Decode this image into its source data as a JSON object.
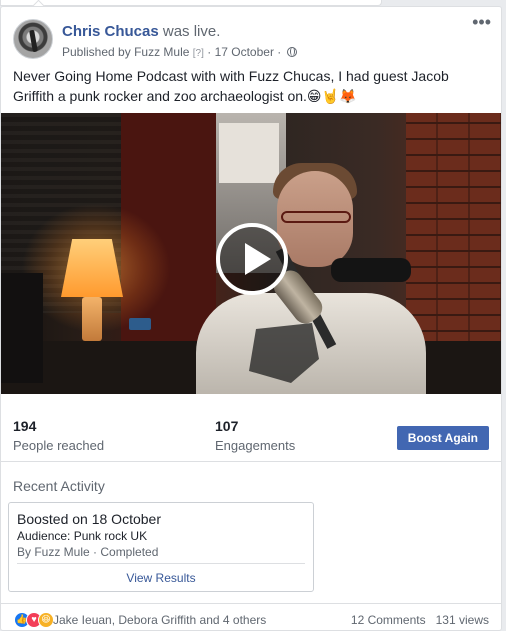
{
  "post": {
    "author": "Chris Chucas",
    "status_text": "was live.",
    "published_prefix": "Published by",
    "publisher": "Fuzz Mule",
    "help_marker": "[?]",
    "date": "17 October",
    "separator": "·",
    "privacy_icon": "globe-icon",
    "more_icon": "•••",
    "text": "Never Going Home Podcast with with Fuzz Chucas, I had guest Jacob Griffith a punk rocker and zoo archaeologist on.😁🤘🦊"
  },
  "video": {
    "play_icon": "play-icon"
  },
  "stats": {
    "reached_count": "194",
    "reached_label": "People reached",
    "engagements_count": "107",
    "engagements_label": "Engagements",
    "boost_label": "Boost Again"
  },
  "recent": {
    "title": "Recent Activity",
    "boost_title": "Boosted on 18 October",
    "audience": "Audience: Punk rock UK",
    "by_line": "By Fuzz Mule · Completed",
    "view_results": "View Results"
  },
  "footer": {
    "reaction_icons": [
      "like-icon",
      "love-icon",
      "haha-icon"
    ],
    "reactors": "Jake Ieuan, Debora Griffith and 4 others",
    "comments": "12 Comments",
    "views": "131 views"
  },
  "colors": {
    "link": "#385898",
    "button": "#4267b2",
    "muted": "#606770"
  }
}
